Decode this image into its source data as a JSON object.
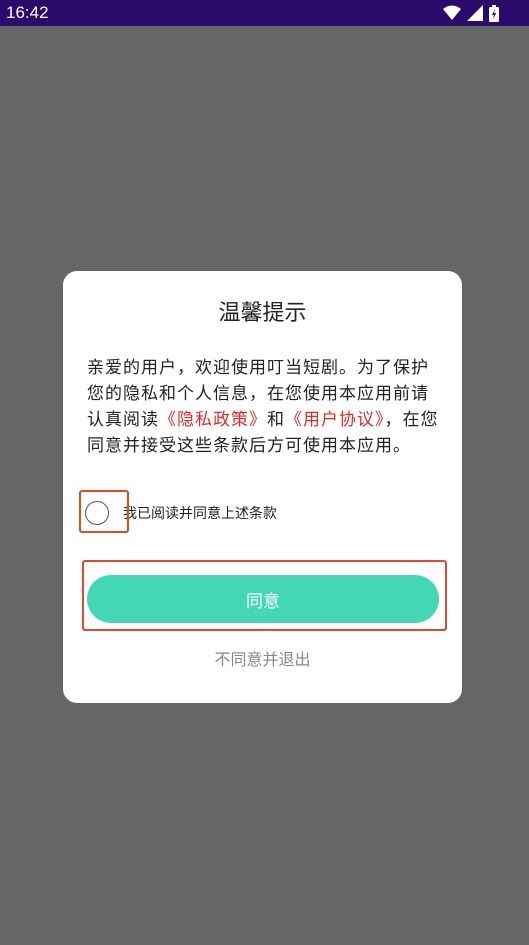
{
  "status_bar": {
    "time": "16:42",
    "icons": [
      "wifi-icon",
      "signal-icon",
      "battery-icon"
    ]
  },
  "dialog": {
    "title": "温馨提示",
    "body": {
      "part1": "亲爱的用户，欢迎使用叮当短剧。为了保护您的隐私和个人信息，在您使用本应用前请认真阅读",
      "privacy_link": "《隐私政策》",
      "part2": "和",
      "user_agreement_link": "《用户协议》",
      "part3": "，在您同意并接受这些条款后方可使用本应用。"
    },
    "checkbox_label": "我已阅读并同意上述条款",
    "checkbox_checked": false,
    "agree_button": "同意",
    "decline_link": "不同意并退出"
  },
  "colors": {
    "status_bar_bg": "#2a0a6a",
    "overlay_bg": "#666666",
    "accent_button": "#44d7b6",
    "link_red": "#e02a2a",
    "highlight_box": "#e04a2a"
  }
}
